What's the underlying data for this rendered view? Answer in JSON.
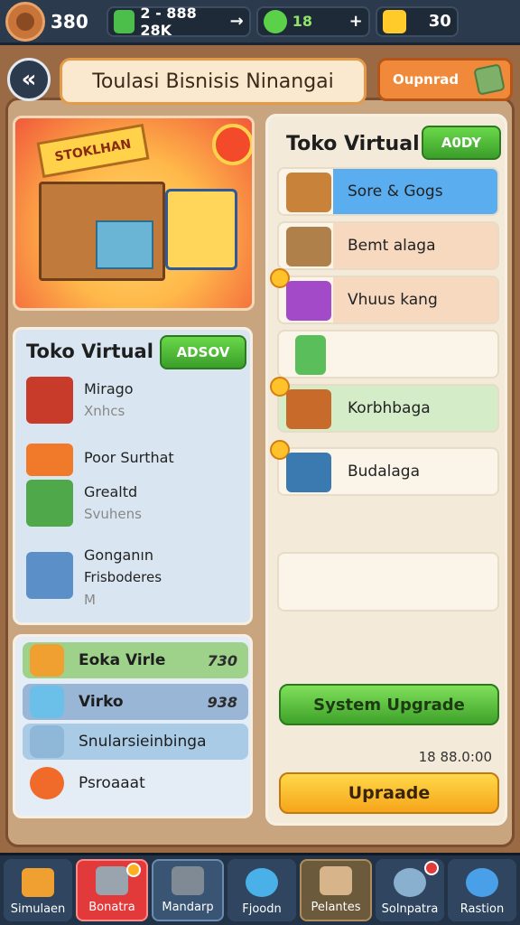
{
  "topbar": {
    "level": "380",
    "resources": [
      {
        "icon": "cash-stack-icon",
        "value": "2 - 888 28K",
        "action": "→",
        "color": "#4cbf4a"
      },
      {
        "icon": "leaf-gem-icon",
        "value": "18",
        "action": "+",
        "color": "#5bd14a"
      },
      {
        "icon": "gold-star-icon",
        "value": "30",
        "action": "",
        "color": "#ffcb2a"
      }
    ]
  },
  "header": {
    "back_label": "«",
    "title": "Toulasi Bisnisis Ninangai",
    "download_label": "Oupnrad"
  },
  "hero": {
    "sign": "STOKLHAN"
  },
  "left_panel": {
    "title": "Toko Virtual",
    "button": "ADSOV",
    "items": [
      {
        "icon": "shopping-cart-icon",
        "name": "Mirago",
        "sub": "Xnhcs",
        "sub2": "",
        "color": "#c83a2a"
      },
      {
        "icon": "toy-car-icon",
        "name": "Poor Surthat",
        "sub": "",
        "sub2": "",
        "color": "#f07a2a"
      },
      {
        "icon": "green-box-icon",
        "name": "Grealtd",
        "sub": "Svuhens",
        "sub2": "",
        "color": "#4fa84a"
      },
      {
        "icon": "shopping-basket-icon",
        "name": "Gonganın",
        "sub": "Frisboderes",
        "sub2": "M",
        "color": "#5a8fc8"
      }
    ]
  },
  "stats": [
    {
      "icon": "camera-icon",
      "label": "Eoka Virle",
      "value": "730",
      "bg": "#9ed28a"
    },
    {
      "icon": "truck-icon",
      "label": "Virko",
      "value": "938",
      "bg": "#9ab6d6"
    },
    {
      "icon": "battery-icon",
      "label": "Snularsieinbinga",
      "value": "",
      "bg": "#a9cbe6"
    },
    {
      "icon": "orange-coin-icon",
      "label": "Psroaaat",
      "value": "",
      "bg": "transparent"
    }
  ],
  "right_panel": {
    "title": "Toko Virtual",
    "button": "A0DY",
    "items": [
      {
        "icon": "cardboard-box-icon",
        "label": "Sore & Gogs",
        "bg": "#5aaef0",
        "starred": false
      },
      {
        "icon": "stacked-boxes-icon",
        "label": "Bemt alaga",
        "bg": "#f7d9c0",
        "starred": false
      },
      {
        "icon": "purple-box-icon",
        "label": "Vhuus kang",
        "bg": "#f7d9c0",
        "starred": true
      },
      {
        "icon": "green-cart-icon",
        "label": "",
        "bg": "#fbf5e9",
        "starred": false
      },
      {
        "icon": "crate-icon",
        "label": "Korbhbaga",
        "bg": "#d4ecc8",
        "starred": true
      },
      {
        "icon": "blue-parcel-icon",
        "label": "Budalaga",
        "bg": "#fbf5e9",
        "starred": true
      },
      {
        "icon": "",
        "label": "",
        "bg": "#fbf5e9",
        "starred": false
      }
    ],
    "system_button": "System Upgrade",
    "timer": "18 88.0:00",
    "upgrade_button": "Upraade"
  },
  "nav": [
    {
      "icon": "home-icon",
      "label": "Simulaen",
      "state": "normal",
      "badge": false
    },
    {
      "icon": "printer-icon",
      "label": "Bonatra",
      "state": "active",
      "badge": true
    },
    {
      "icon": "machine-icon",
      "label": "Mandarp",
      "state": "sel2",
      "badge": false
    },
    {
      "icon": "compass-icon",
      "label": "Fjoodn",
      "state": "normal",
      "badge": false
    },
    {
      "icon": "package-icon",
      "label": "Pelantes",
      "state": "sel2",
      "badge": false
    },
    {
      "icon": "coins-icon",
      "label": "Solnpatra",
      "state": "normal",
      "badge": true
    },
    {
      "icon": "globe-icon",
      "label": "Rastion",
      "state": "normal",
      "badge": false
    }
  ]
}
